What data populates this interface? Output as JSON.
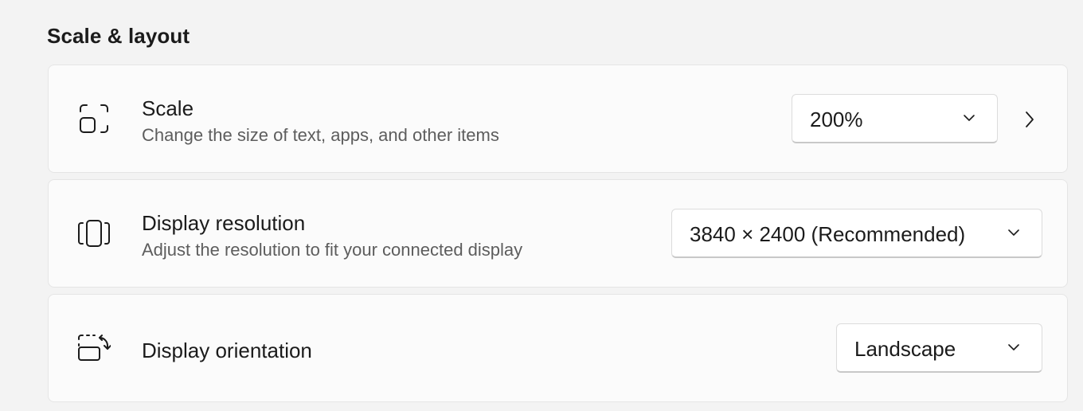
{
  "section": {
    "title": "Scale & layout"
  },
  "scale": {
    "title": "Scale",
    "description": "Change the size of text, apps, and other items",
    "selected": "200%",
    "icon": "scale-icon"
  },
  "resolution": {
    "title": "Display resolution",
    "description": "Adjust the resolution to fit your connected display",
    "selected": "3840 × 2400 (Recommended)",
    "icon": "display-resolution-icon"
  },
  "orientation": {
    "title": "Display orientation",
    "selected": "Landscape",
    "icon": "display-orientation-icon"
  },
  "colors": {
    "background": "#f3f3f3",
    "card": "#fbfbfb",
    "text": "#1b1b1b",
    "secondary_text": "#5d5d5d"
  }
}
